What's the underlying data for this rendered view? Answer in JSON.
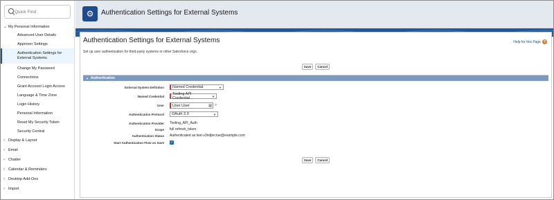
{
  "sidebar": {
    "quickfind_placeholder": "Quick Find",
    "personal_group": "My Personal Information",
    "items": [
      "Advanced User Details",
      "Approver Settings",
      "Authentication Settings for External Systems",
      "Change My Password",
      "Connections",
      "Grant Account Login Access",
      "Language & Time Zone",
      "Login History",
      "Personal Information",
      "Reset My Security Token",
      "Security Central"
    ],
    "groups": [
      "Display & Layout",
      "Email",
      "Chatter",
      "Calendar & Reminders",
      "Desktop Add-Ons",
      "Import"
    ]
  },
  "header": {
    "title": "Authentication Settings for External Systems"
  },
  "page": {
    "title": "Authentication Settings for External Systems",
    "help": "Help for this Page",
    "subtitle": "Set up user authentication for third-party systems or other Salesforce orgs."
  },
  "buttons": {
    "save": "Save",
    "cancel": "Cancel"
  },
  "section": {
    "title": "Authentication",
    "fields": {
      "esd_label": "External System Definition",
      "esd_value": "Named Credential",
      "nc_label": "Named Credential",
      "nc_value": "Tooling API Credential",
      "user_label": "User",
      "user_value": "User User",
      "protocol_label": "Authentication Protocol",
      "protocol_value": "OAuth 2.0",
      "provider_label": "Authentication Provider",
      "provider_value": "Tooling_API_Auth",
      "scope_label": "Scope",
      "scope_value": "full refresh_token",
      "status_label": "Authentication Status",
      "status_value": "Authenticated as test-v3ndjlecrue@example.com",
      "flow_label": "Start Authentication Flow on Save",
      "flow_checked": true
    }
  }
}
